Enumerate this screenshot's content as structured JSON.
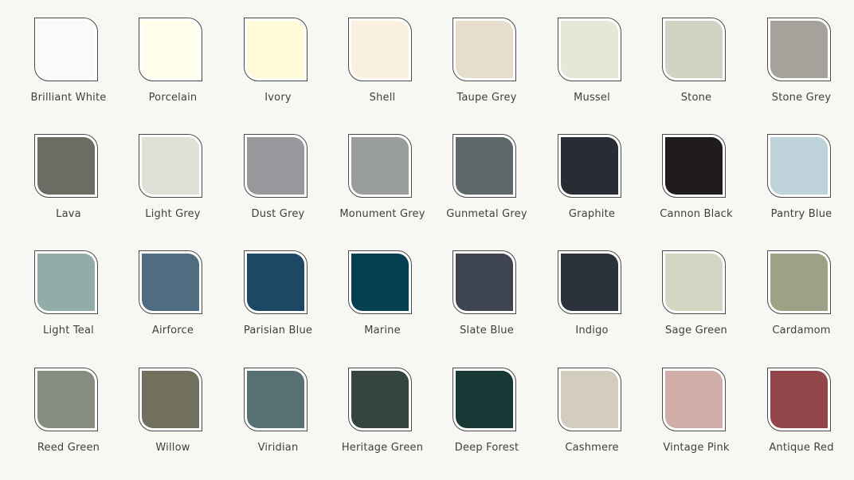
{
  "swatches": [
    {
      "name": "Brilliant White",
      "color": "#fafaf8"
    },
    {
      "name": "Porcelain",
      "color": "#fffeea"
    },
    {
      "name": "Ivory",
      "color": "#fffad7"
    },
    {
      "name": "Shell",
      "color": "#faf0e0"
    },
    {
      "name": "Taupe Grey",
      "color": "#e6ddcd"
    },
    {
      "name": "Mussel",
      "color": "#e6e7d7"
    },
    {
      "name": "Stone",
      "color": "#d3d3c4"
    },
    {
      "name": "Stone Grey",
      "color": "#a6a19a"
    },
    {
      "name": "Lava",
      "color": "#6c6c65"
    },
    {
      "name": "Light Grey",
      "color": "#e0e0d6"
    },
    {
      "name": "Dust Grey",
      "color": "#97989b"
    },
    {
      "name": "Monument Grey",
      "color": "#999e9c"
    },
    {
      "name": "Gunmetal Grey",
      "color": "#5e686b"
    },
    {
      "name": "Graphite",
      "color": "#282d33"
    },
    {
      "name": "Cannon Black",
      "color": "#201c1d"
    },
    {
      "name": "Pantry Blue",
      "color": "#bdd3d9"
    },
    {
      "name": "Light Teal",
      "color": "#92aca7"
    },
    {
      "name": "Airforce",
      "color": "#506c80"
    },
    {
      "name": "Parisian Blue",
      "color": "#1c4866"
    },
    {
      "name": "Marine",
      "color": "#053f52"
    },
    {
      "name": "Slate Blue",
      "color": "#3f4550"
    },
    {
      "name": "Indigo",
      "color": "#2c323c"
    },
    {
      "name": "Sage Green",
      "color": "#d2d6c3"
    },
    {
      "name": "Cardamom",
      "color": "#9da287"
    },
    {
      "name": "Reed Green",
      "color": "#848d80"
    },
    {
      "name": "Willow",
      "color": "#71705c"
    },
    {
      "name": "Viridian",
      "color": "#587073"
    },
    {
      "name": "Heritage Green",
      "color": "#35453e"
    },
    {
      "name": "Deep Forest",
      "color": "#183836"
    },
    {
      "name": "Cashmere",
      "color": "#d3cdbf"
    },
    {
      "name": "Vintage Pink",
      "color": "#d1ada7"
    },
    {
      "name": "Antique Red",
      "color": "#92464a"
    }
  ]
}
